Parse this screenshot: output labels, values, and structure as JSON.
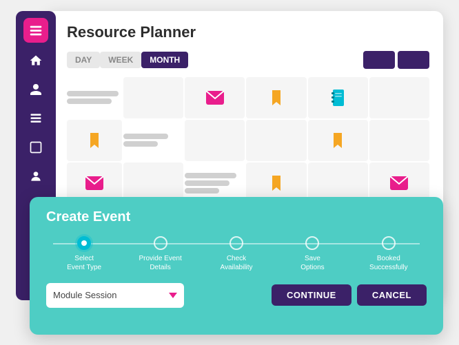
{
  "sidebar": {
    "items": [
      {
        "label": "home",
        "icon": "home-icon"
      },
      {
        "label": "person",
        "icon": "person-icon"
      },
      {
        "label": "box",
        "icon": "box-icon"
      },
      {
        "label": "box2",
        "icon": "box2-icon"
      },
      {
        "label": "person2",
        "icon": "person2-icon"
      }
    ]
  },
  "panel": {
    "title": "Resource Planner",
    "tabs": [
      {
        "label": "DAY",
        "active": false
      },
      {
        "label": "WEEK",
        "active": false
      },
      {
        "label": "MONTH",
        "active": true
      }
    ]
  },
  "modal": {
    "title": "Create Event",
    "steps": [
      {
        "label": "Select\nEvent Type",
        "active": true
      },
      {
        "label": "Provide Event\nDetails",
        "active": false
      },
      {
        "label": "Check\nAvailability",
        "active": false
      },
      {
        "label": "Save\nOptions",
        "active": false
      },
      {
        "label": "Booked\nSuccessfully",
        "active": false
      }
    ],
    "dropdown": {
      "value": "Module Session",
      "placeholder": "Module Session"
    },
    "buttons": {
      "continue": "CONTINUE",
      "cancel": "CANCEL"
    }
  }
}
